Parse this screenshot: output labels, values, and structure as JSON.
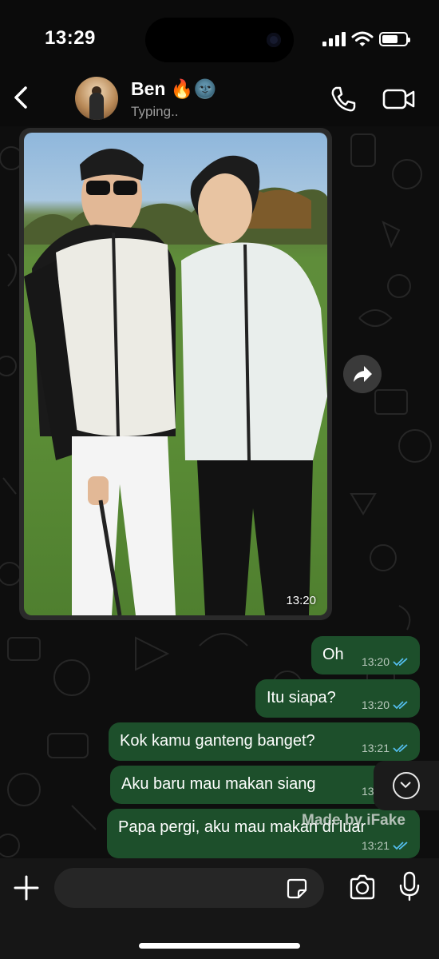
{
  "status_bar": {
    "time": "13:29"
  },
  "header": {
    "back_icon": "chevron-left-icon",
    "contact_name": "Ben 🔥🌚",
    "contact_status": "Typing..",
    "call_icon": "phone-icon",
    "video_icon": "video-camera-icon"
  },
  "image_message": {
    "time": "13:20"
  },
  "messages": [
    {
      "text": "Oh",
      "time": "13:20",
      "status": "read"
    },
    {
      "text": "Itu siapa?",
      "time": "13:20",
      "status": "read"
    },
    {
      "text": "Kok kamu ganteng banget?",
      "time": "13:21",
      "status": "read"
    },
    {
      "text": "Aku baru mau makan siang",
      "time": "13:21",
      "status": "read"
    },
    {
      "text": "Papa pergi, aku mau makan di luar",
      "time": "13:21",
      "status": "read"
    }
  ],
  "watermark": "Made by iFake",
  "input_bar": {
    "placeholder": ""
  },
  "colors": {
    "outgoing_bubble": "#1d4f2b",
    "read_ticks": "#53bdeb",
    "background": "#0e0e0e"
  }
}
